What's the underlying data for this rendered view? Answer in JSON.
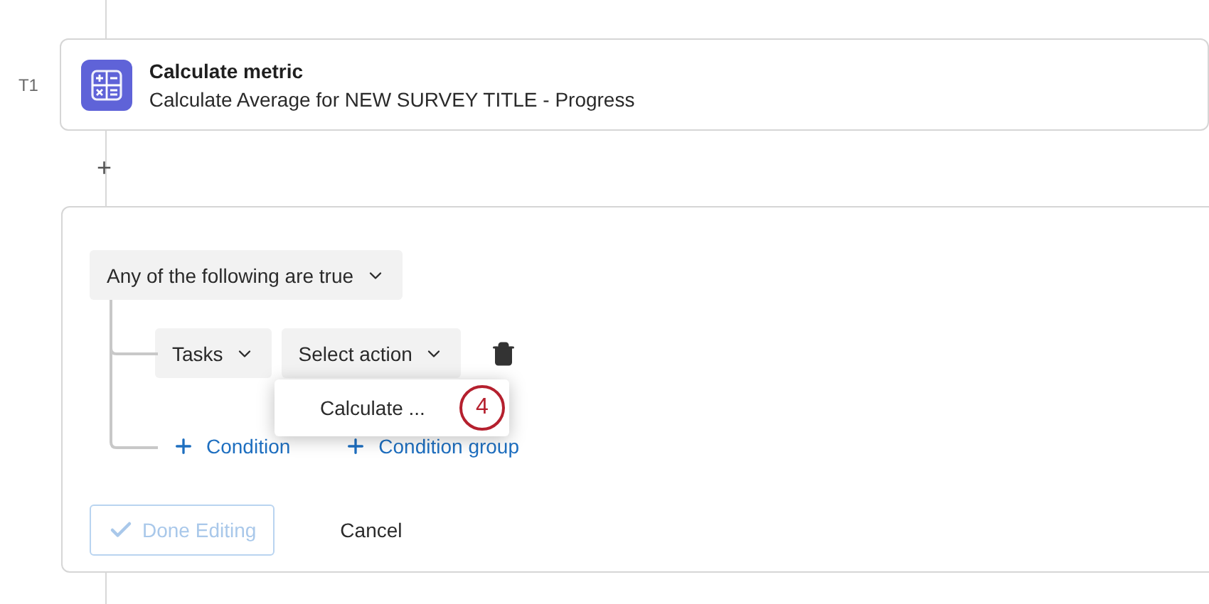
{
  "task": {
    "label": "T1",
    "title": "Calculate metric",
    "description": "Calculate Average for NEW SURVEY TITLE - Progress"
  },
  "add_step": "+",
  "condition_editor": {
    "match_dropdown": "Any of the following are true",
    "condition": {
      "field_dropdown": "Tasks",
      "action_dropdown": "Select action"
    },
    "menu": {
      "open": true,
      "items": [
        {
          "label": "Calculate ...",
          "badge": "4"
        }
      ]
    },
    "links": [
      "Condition",
      "Condition group"
    ],
    "buttons": [
      {
        "label": "Done Editing",
        "kind": "primary",
        "disabled": true
      },
      {
        "label": "Cancel",
        "kind": "plain",
        "disabled": false
      }
    ]
  }
}
